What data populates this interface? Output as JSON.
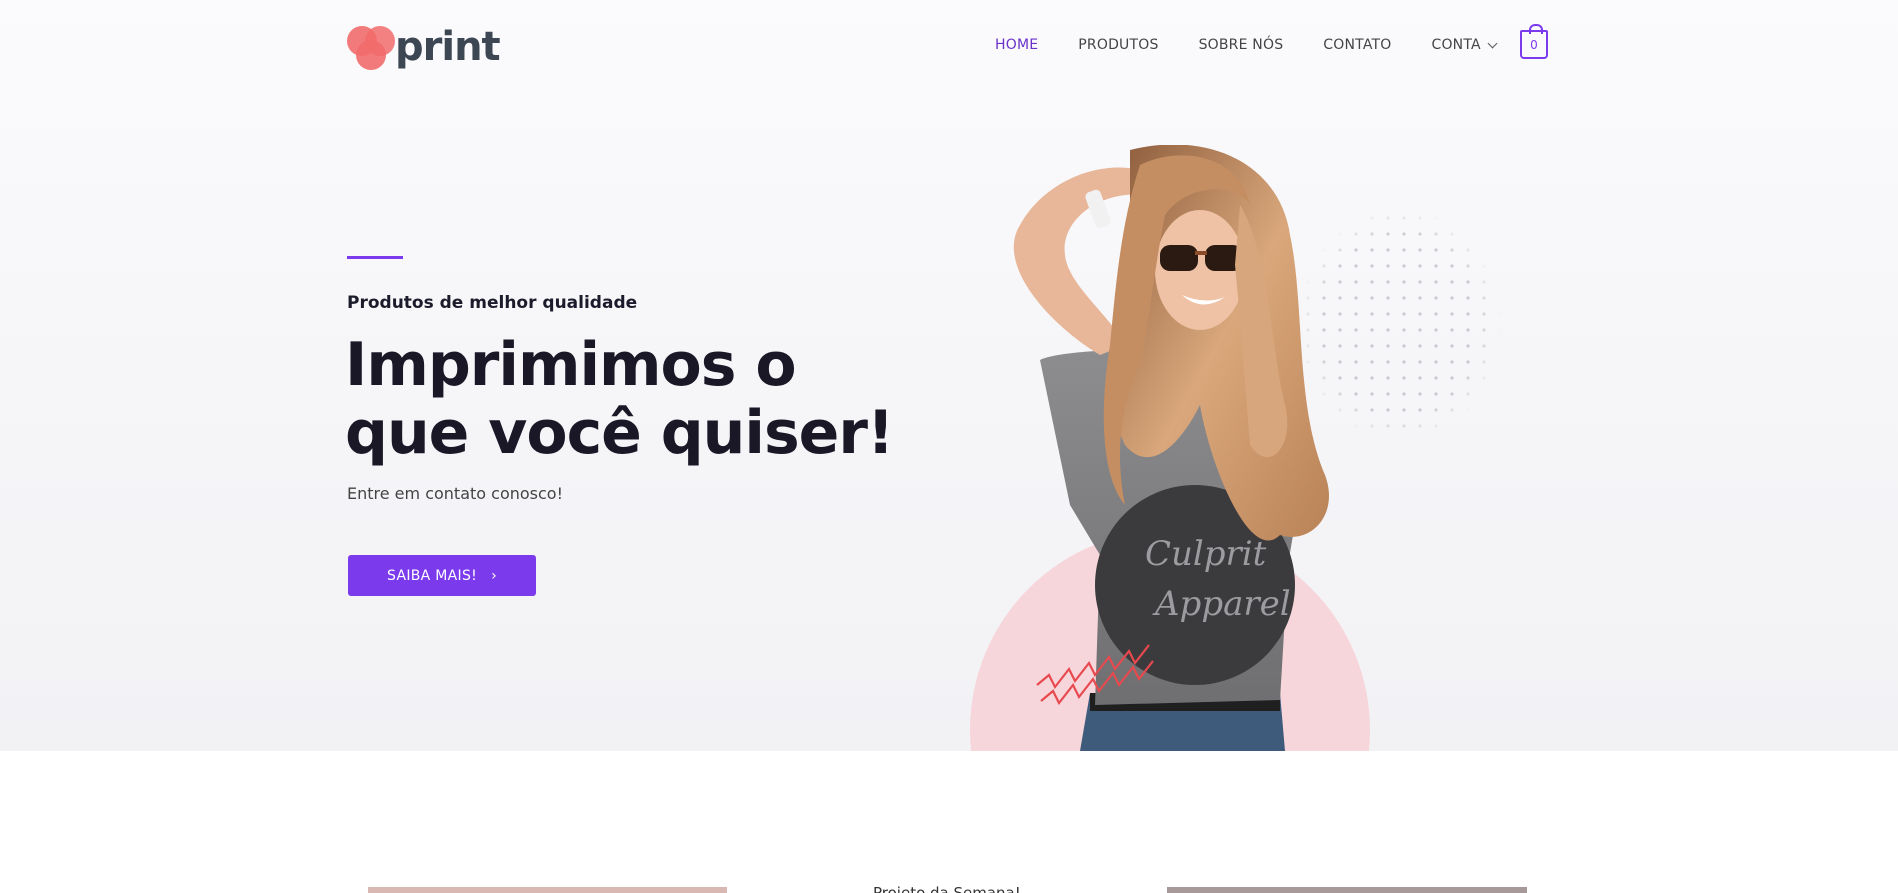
{
  "brand": {
    "name": "print",
    "logo_color": "#f26b6b",
    "text_color": "#3d4653"
  },
  "nav": {
    "items": [
      {
        "label": "HOME",
        "active": true
      },
      {
        "label": "PRODUTOS",
        "active": false
      },
      {
        "label": "SOBRE NÓS",
        "active": false
      },
      {
        "label": "CONTATO",
        "active": false
      },
      {
        "label": "CONTA",
        "active": false,
        "has_dropdown": true
      }
    ],
    "cart_count": "0",
    "cart_icon": "shopping-bag-icon"
  },
  "hero": {
    "subtitle": "Produtos de melhor qualidade",
    "headline_line1": "Imprimimos o",
    "headline_line2": "que você quiser!",
    "lead": "Entre em contato conosco!",
    "cta_label": "SAIBA MAIS!",
    "cta_icon": "chevron-right-icon",
    "accent_color": "#7c3aed"
  },
  "section": {
    "project_title": "Projeto da Semana!"
  }
}
